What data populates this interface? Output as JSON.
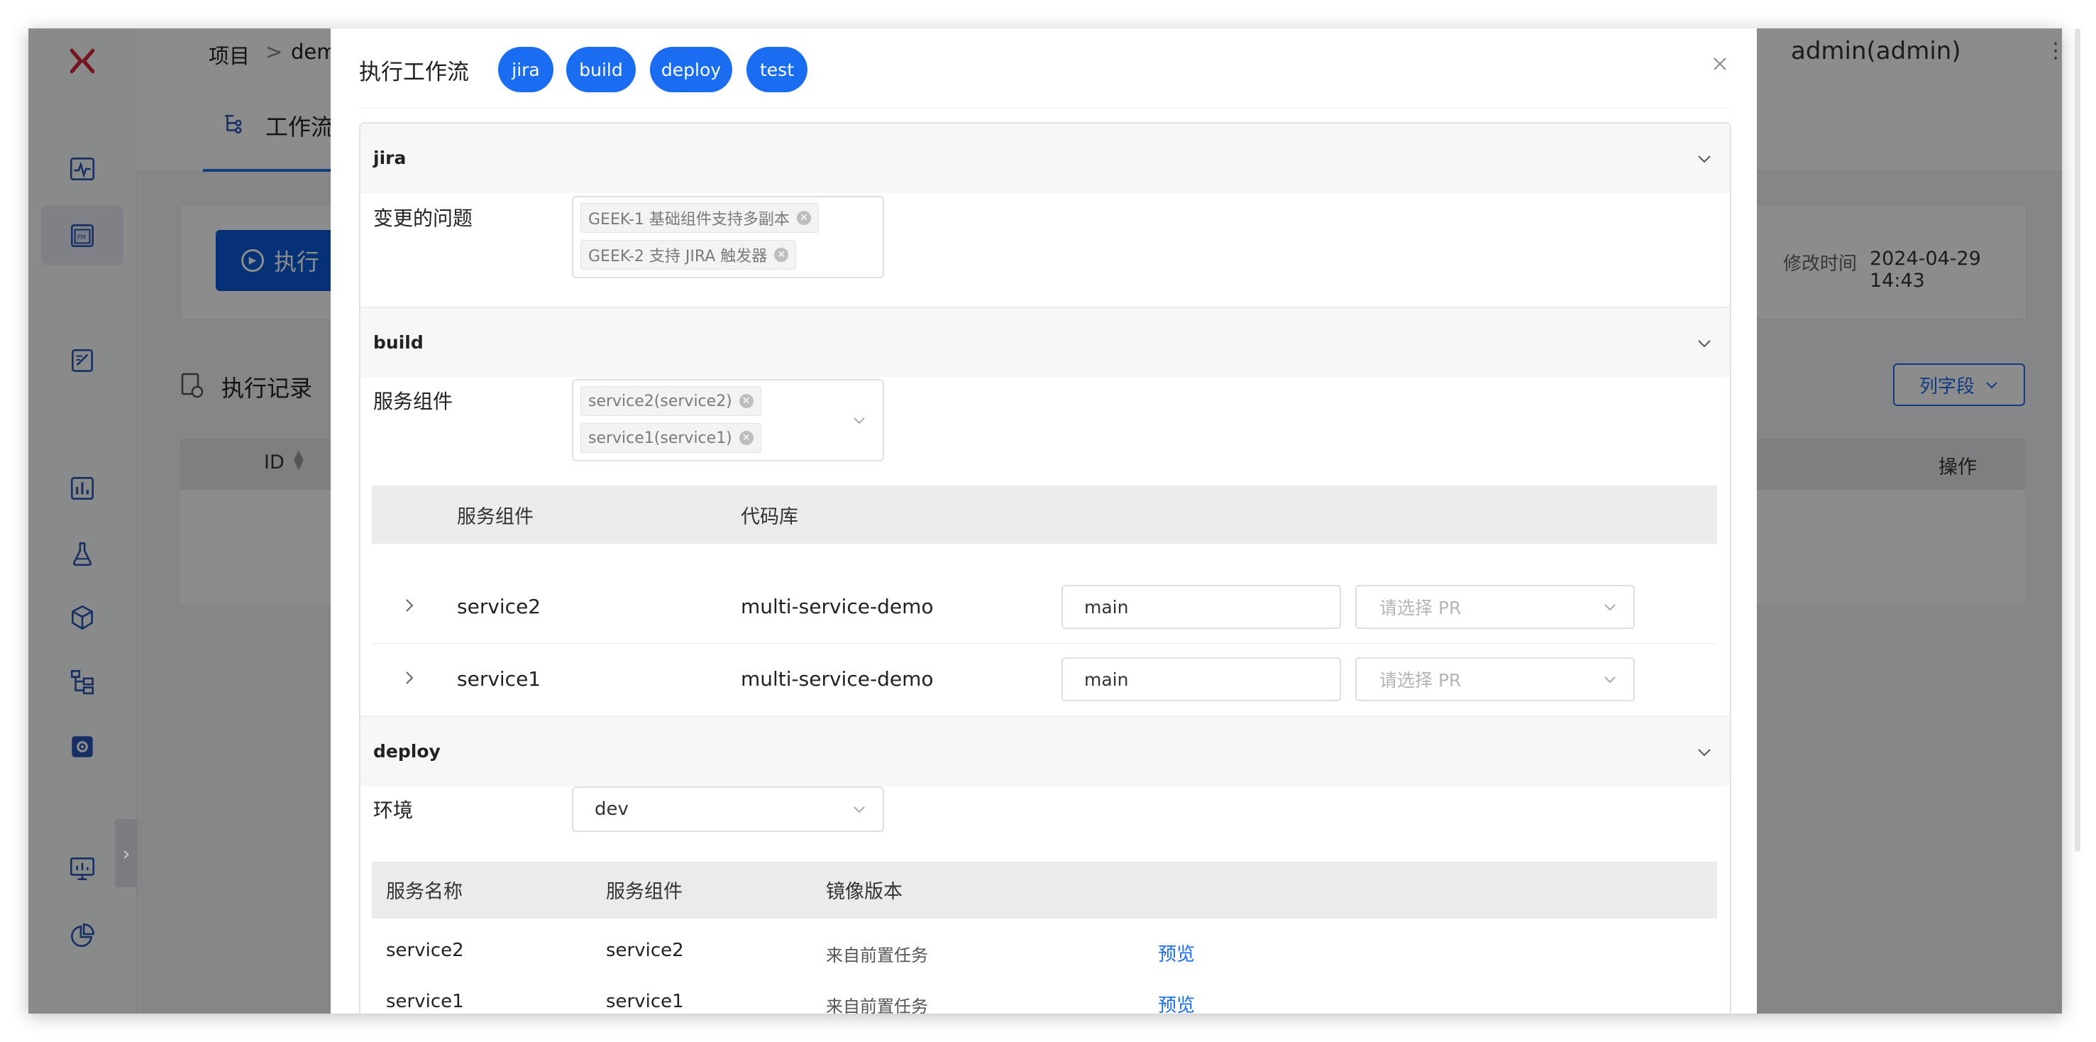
{
  "background": {
    "breadcrumb": {
      "root": "项目",
      "sep": ">",
      "project": "demo"
    },
    "user": "admin(admin)",
    "tab_workflow": "工作流",
    "run_button": "执行",
    "modified_label": "修改时间",
    "modified_value": "2024-04-29 14:43",
    "records_title": "执行记录",
    "columns_button": "列字段",
    "table_headers": {
      "id": "ID",
      "ops": "操作"
    }
  },
  "modal": {
    "title": "执行工作流",
    "stage_pills": [
      "jira",
      "build",
      "deploy",
      "test"
    ],
    "jira": {
      "name": "jira",
      "issues_label": "变更的问题",
      "issues": [
        "GEEK-1 基础组件支持多副本",
        "GEEK-2 支持 JIRA 触发器"
      ]
    },
    "build": {
      "name": "build",
      "components_label": "服务组件",
      "components": [
        "service2(service2)",
        "service1(service1)"
      ],
      "table_headers": {
        "component": "服务组件",
        "repo": "代码库"
      },
      "rows": [
        {
          "service": "service2",
          "repo": "multi-service-demo",
          "branch": "main",
          "pr_placeholder": "请选择 PR"
        },
        {
          "service": "service1",
          "repo": "multi-service-demo",
          "branch": "main",
          "pr_placeholder": "请选择 PR"
        }
      ]
    },
    "deploy": {
      "name": "deploy",
      "env_label": "环境",
      "env_value": "dev",
      "table_headers": {
        "service_name": "服务名称",
        "component": "服务组件",
        "image": "镜像版本"
      },
      "rows": [
        {
          "service_name": "service2",
          "component": "service2",
          "image": "来自前置任务",
          "action": "预览"
        },
        {
          "service_name": "service1",
          "component": "service1",
          "image": "来自前置任务",
          "action": "预览"
        }
      ]
    }
  },
  "colors": {
    "primary": "#1a6cf1",
    "brand_red": "#d9263a",
    "overlay": "rgba(0,0,0,0.45)"
  },
  "icons": {
    "sidebar": [
      "logo-x-icon",
      "monitor-icon",
      "project-icon",
      "edit-doc-icon",
      "dashboard-icon",
      "flask-icon",
      "package-icon",
      "workflow-tree-icon",
      "settings-icon",
      "display-icon",
      "pie-chart-icon"
    ]
  }
}
